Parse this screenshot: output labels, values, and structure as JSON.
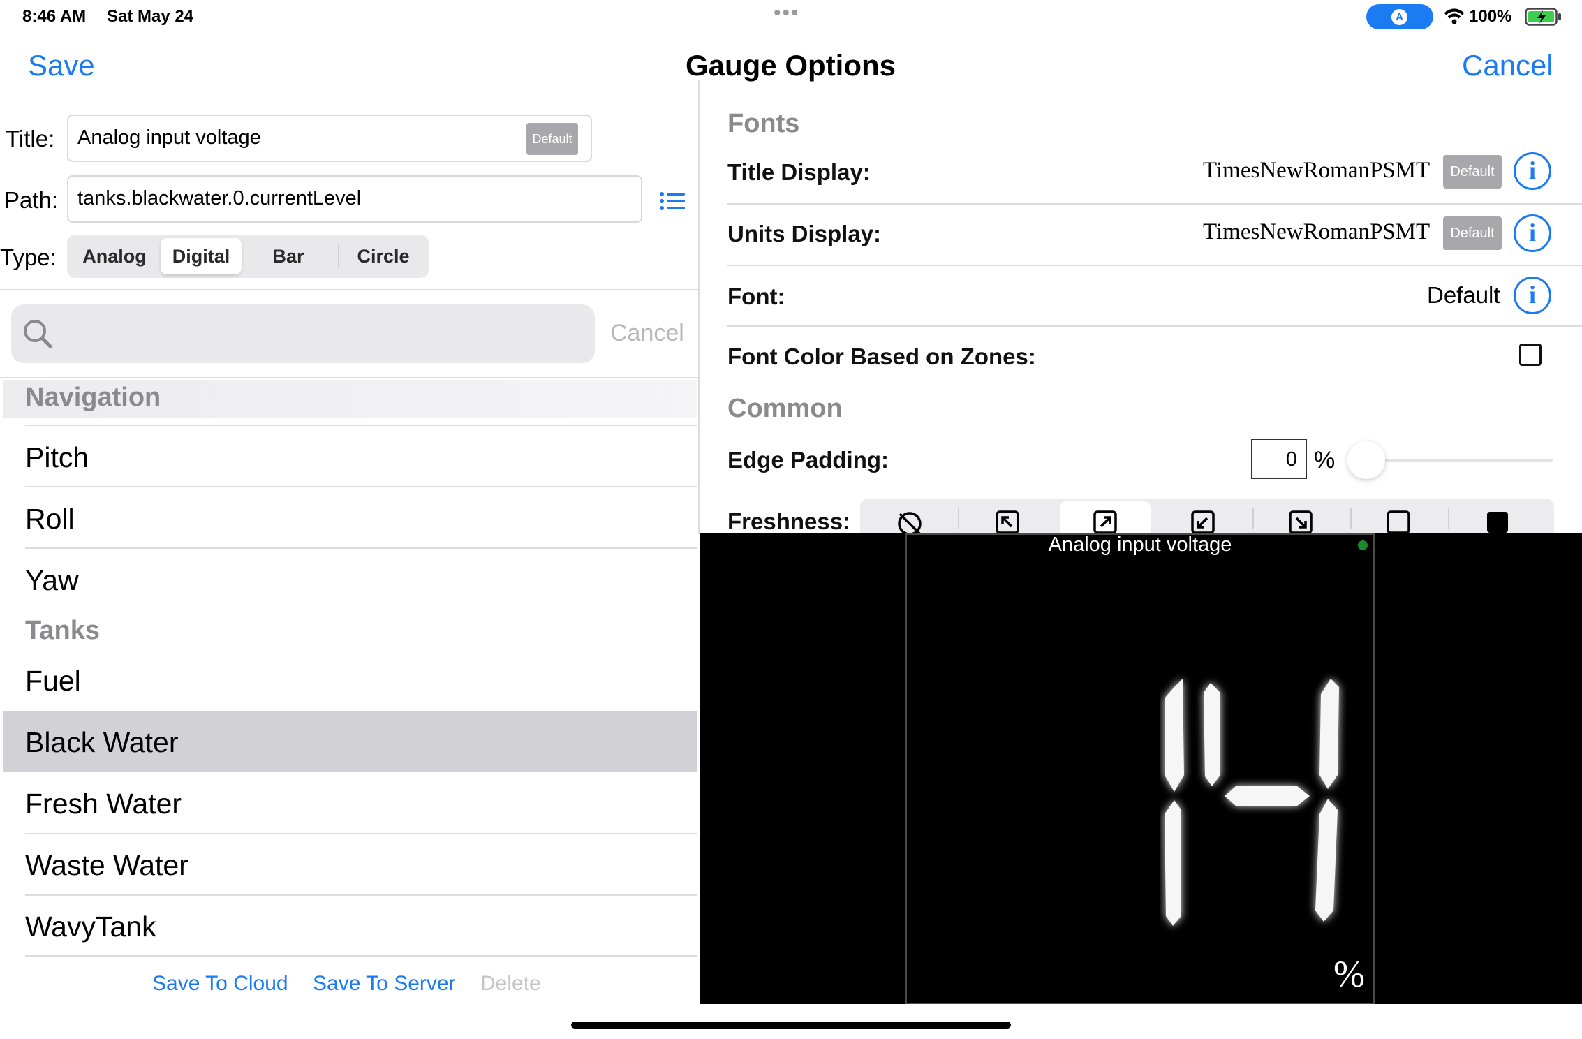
{
  "status_bar": {
    "time": "8:46 AM",
    "date": "Sat May 24",
    "location_icon": "location-arrow-icon",
    "wifi_icon": "wifi-icon",
    "battery_percent": "100%",
    "battery_icon": "battery-charging-icon"
  },
  "nav": {
    "save_label": "Save",
    "title": "Gauge Options",
    "cancel_label": "Cancel"
  },
  "form": {
    "title_label": "Title:",
    "title_value": "Analog input voltage",
    "title_default_badge": "Default",
    "path_label": "Path:",
    "path_value": "tanks.blackwater.0.currentLevel",
    "path_list_icon": "list-icon",
    "type_label": "Type:",
    "type_options": [
      "Analog",
      "Digital",
      "Bar",
      "Circle"
    ],
    "type_selected": "Digital"
  },
  "search": {
    "icon": "search-icon",
    "cancel_label": "Cancel"
  },
  "list": {
    "section_navigation": "Navigation",
    "navigation_items": [
      "Pitch",
      "Roll",
      "Yaw"
    ],
    "section_tanks": "Tanks",
    "tank_items": [
      "Fuel",
      "Black Water",
      "Fresh Water",
      "Waste Water",
      "WavyTank"
    ],
    "selected_item": "Black Water"
  },
  "footer": {
    "save_cloud": "Save To Cloud",
    "save_server": "Save To Server",
    "delete": "Delete"
  },
  "options": {
    "fonts_header": "Fonts",
    "title_display_label": "Title Display:",
    "title_display_value": "TimesNewRomanPSMT",
    "title_display_default": "Default",
    "units_display_label": "Units Display:",
    "units_display_value": "TimesNewRomanPSMT",
    "units_display_default": "Default",
    "font_label": "Font:",
    "font_value": "Default",
    "font_color_zones_label": "Font Color Based on Zones:",
    "font_color_zones_checked": false,
    "common_header": "Common",
    "edge_padding_label": "Edge Padding:",
    "edge_padding_value": "0",
    "edge_padding_unit": "%",
    "edge_padding_slider_fraction": 0,
    "freshness_label": "Freshness:",
    "freshness_icons": [
      "freshness-off-icon",
      "corner-top-left-icon",
      "corner-top-right-icon",
      "corner-bottom-left-icon",
      "corner-bottom-right-icon",
      "square-outline-icon",
      "square-filled-icon"
    ],
    "freshness_selected_index": 2
  },
  "gauge_preview": {
    "title": "Analog input voltage",
    "value": "14",
    "units": "%",
    "freshness_dot_color": "#1a8a2a"
  },
  "colors": {
    "accent": "#1a7bf2",
    "selected_row": "#d1d1d6",
    "section_gray": "#8a8a8e"
  }
}
